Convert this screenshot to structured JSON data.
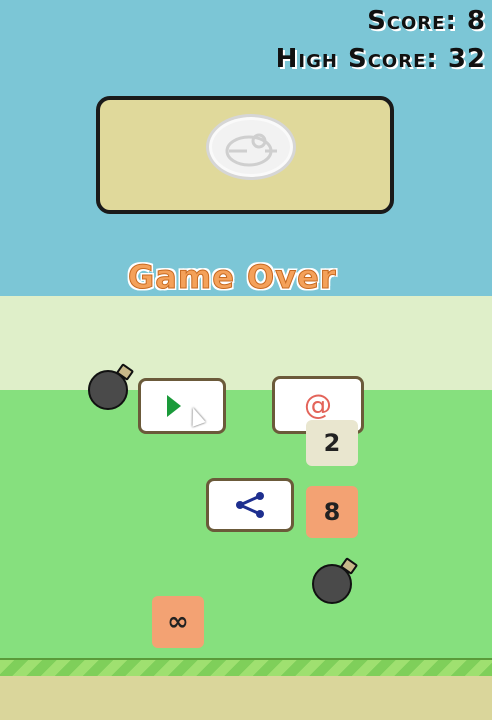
{
  "hud": {
    "score_label": "Score: 8",
    "high_score_label": "High Score: 32"
  },
  "game_over": {
    "title": "Game Over"
  },
  "buttons": {
    "play_icon": "play-icon",
    "email_label": "@",
    "share_icon": "share-icon"
  },
  "tiles": [
    {
      "value": "2"
    },
    {
      "value": "8"
    },
    {
      "value": "∞"
    }
  ],
  "colors": {
    "sky": "#7cc6d6",
    "grass": "#86e07e",
    "ground": "#dad69b",
    "game_over_text": "#f4a15a",
    "tile_orange": "#f3a273",
    "tile_light": "#e9e6cf",
    "panel": "#e0d99b"
  }
}
